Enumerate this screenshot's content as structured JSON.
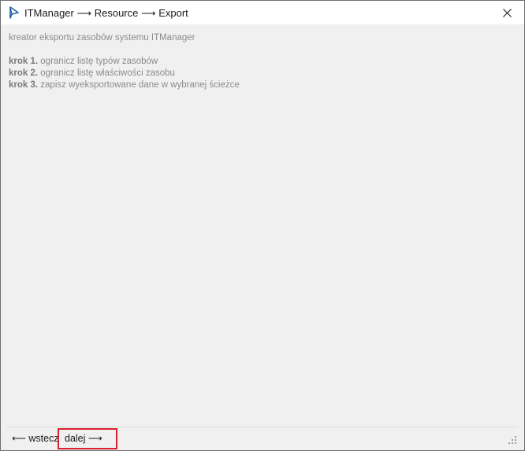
{
  "window": {
    "title": "ITManager ⟶ Resource ⟶ Export",
    "icon": "app-logo-icon",
    "close_icon": "close-icon"
  },
  "content": {
    "intro": "kreator eksportu zasobów systemu ITManager",
    "steps": [
      {
        "label": "krok 1.",
        "text": "ogranicz listę typów zasobów"
      },
      {
        "label": "krok 2.",
        "text": "ogranicz listę właściwości zasobu"
      },
      {
        "label": "krok 3.",
        "text": "zapisz wyeksportowane dane w wybranej ścieżce"
      }
    ]
  },
  "footer": {
    "back_label": "⟵ wstecz",
    "next_label": "dalej ⟶",
    "highlight_color": "#d8212f"
  }
}
